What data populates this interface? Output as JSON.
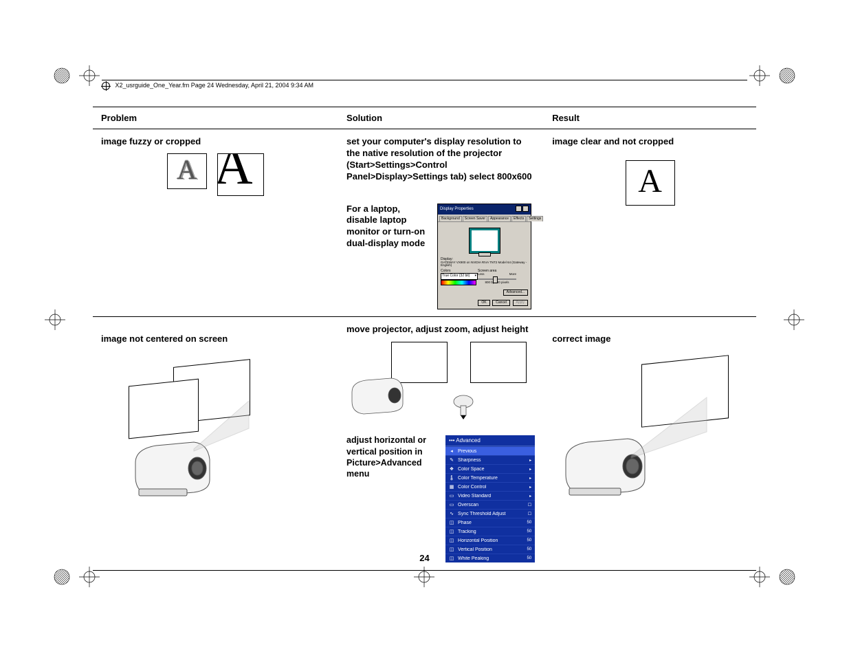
{
  "header": {
    "file_info": "X2_usrguide_One_Year.fm  Page 24  Wednesday, April 21, 2004  9:34 AM"
  },
  "table": {
    "headers": {
      "problem": "Problem",
      "solution": "Solution",
      "result": "Result"
    },
    "row1": {
      "problem": "image fuzzy or cropped",
      "solution_main": "set your computer's display resolution to the native resolution of the projector (Start>Settings>Control Panel>Display>Settings tab) select 800x600",
      "solution_sub": "For a laptop, disable laptop monitor or turn-on dual-display mode",
      "result": "image clear and not cropped",
      "letter": "A",
      "dp": {
        "title": "Display Properties",
        "tabs": [
          "Background",
          "Screen Saver",
          "Appearance",
          "Effects",
          "Settings"
        ],
        "display_label": "Display:",
        "display_value": "GATEWAY VX900 on NVIDIA RIVA TNT2 Model 64 (Gateway - English)",
        "colors_label": "Colors",
        "colors_value": "True Color (32 bit)",
        "area_label": "Screen area",
        "less": "Less",
        "more": "More",
        "resolution": "800 by 600 pixels",
        "advanced": "Advanced...",
        "ok": "OK",
        "cancel": "Cancel",
        "apply": "Apply"
      }
    },
    "row2": {
      "problem": "image not centered on screen",
      "solution_main": "move projector, adjust zoom, adjust height",
      "solution_sub": "adjust horizontal or vertical position in Picture>Advanced menu",
      "result": "correct image",
      "osd": {
        "title": "Advanced",
        "previous": "Previous",
        "items": [
          {
            "label": "Sharpness",
            "val": "▸"
          },
          {
            "label": "Color Space",
            "val": "▸"
          },
          {
            "label": "Color Temperature",
            "val": "▸"
          },
          {
            "label": "Color Control",
            "val": "▸"
          },
          {
            "label": "Video Standard",
            "val": "▸"
          },
          {
            "label": "Overscan",
            "val": "☐"
          },
          {
            "label": "Sync Threshold Adjust",
            "val": "☐"
          },
          {
            "label": "Phase",
            "val": "50"
          },
          {
            "label": "Tracking",
            "val": "50"
          },
          {
            "label": "Horizontal Position",
            "val": "50"
          },
          {
            "label": "Vertical Position",
            "val": "50"
          },
          {
            "label": "White Peaking",
            "val": "50"
          }
        ]
      }
    }
  },
  "page_number": "24"
}
